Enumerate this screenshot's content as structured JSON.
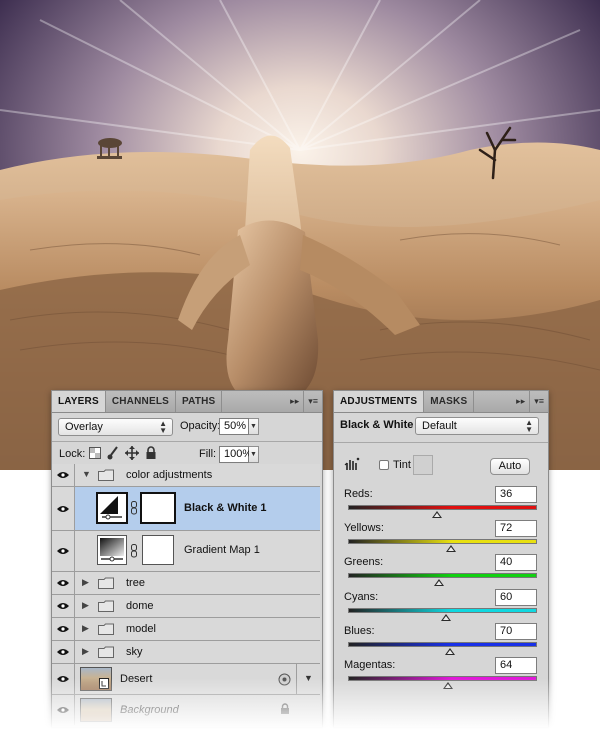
{
  "layers_panel": {
    "tabs": [
      {
        "label": "LAYERS",
        "active": true
      },
      {
        "label": "CHANNELS",
        "active": false
      },
      {
        "label": "PATHS",
        "active": false
      }
    ],
    "collapse_glyph": "▸▸",
    "menu_glyph": "▾≡",
    "blend_mode": "Overlay",
    "opacity_label": "Opacity:",
    "opacity_value": "50%",
    "lock_label": "Lock:",
    "fill_label": "Fill:",
    "fill_value": "100%",
    "layers": [
      {
        "name": "color adjustments",
        "kind": "group",
        "expanded": true,
        "visible": true
      },
      {
        "name": "Black & White 1",
        "kind": "adjustment",
        "selected": true,
        "visible": true
      },
      {
        "name": "Gradient Map 1",
        "kind": "adjustment",
        "selected": false,
        "visible": true
      },
      {
        "name": "tree",
        "kind": "group",
        "expanded": false,
        "visible": true
      },
      {
        "name": "dome",
        "kind": "group",
        "expanded": false,
        "visible": true
      },
      {
        "name": "model",
        "kind": "group",
        "expanded": false,
        "visible": true
      },
      {
        "name": "sky",
        "kind": "group",
        "expanded": false,
        "visible": true
      },
      {
        "name": "Desert",
        "kind": "smart-object",
        "visible": true
      },
      {
        "name": "Background",
        "kind": "background",
        "visible": true
      }
    ]
  },
  "adjustments_panel": {
    "tabs": [
      {
        "label": "ADJUSTMENTS",
        "active": true
      },
      {
        "label": "MASKS",
        "active": false
      }
    ],
    "collapse_glyph": "▸▸",
    "menu_glyph": "▾≡",
    "adjustment_title": "Black & White",
    "preset": "Default",
    "tint_label": "Tint",
    "tint_checked": false,
    "auto_label": "Auto",
    "sliders": [
      {
        "label": "Reds:",
        "value": "36",
        "pos": 36,
        "min": -200,
        "max": 300,
        "gradient": [
          "#222222",
          "#e01010"
        ]
      },
      {
        "label": "Yellows:",
        "value": "72",
        "pos": 72,
        "min": -200,
        "max": 300,
        "gradient": [
          "#222222",
          "#e8e010"
        ]
      },
      {
        "label": "Greens:",
        "value": "40",
        "pos": 40,
        "min": -200,
        "max": 300,
        "gradient": [
          "#222222",
          "#10d010"
        ]
      },
      {
        "label": "Cyans:",
        "value": "60",
        "pos": 60,
        "min": -200,
        "max": 300,
        "gradient": [
          "#222222",
          "#10d8e0"
        ]
      },
      {
        "label": "Blues:",
        "value": "70",
        "pos": 70,
        "min": -200,
        "max": 300,
        "gradient": [
          "#222222",
          "#1830e8"
        ]
      },
      {
        "label": "Magentas:",
        "value": "64",
        "pos": 64,
        "min": -200,
        "max": 300,
        "gradient": [
          "#222222",
          "#e018d8"
        ]
      }
    ]
  },
  "colors": {
    "selection": "#b4cdec",
    "panel": "#d6d6d6"
  }
}
